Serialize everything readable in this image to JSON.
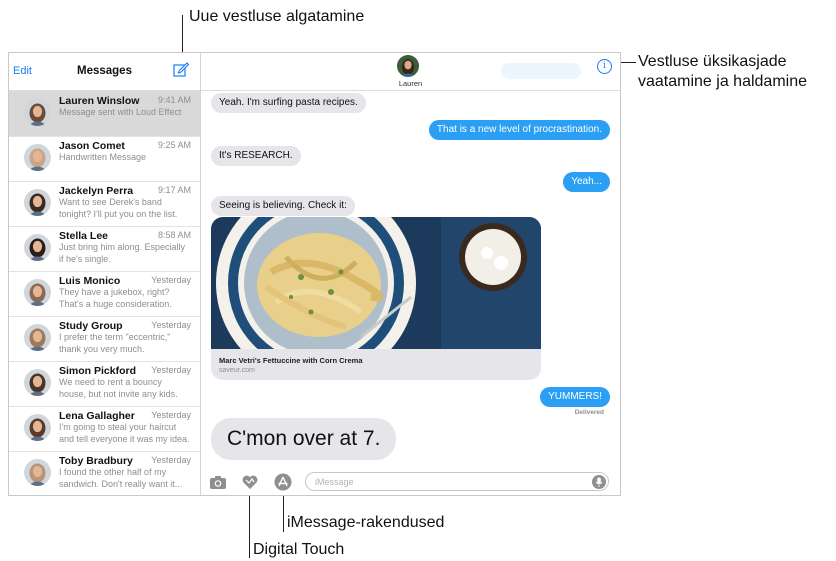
{
  "callouts": {
    "new_conversation": "Uue vestluse algatamine",
    "details_line1": "Vestluse üksikasjade",
    "details_line2": "vaatamine ja haldamine",
    "imessage_apps": "iMessage-rakendused",
    "digital_touch": "Digital Touch"
  },
  "sidebar": {
    "edit_label": "Edit",
    "title": "Messages",
    "compose_icon": "compose-icon",
    "conversations": [
      {
        "name": "Lauren Winslow",
        "time": "9:41 AM",
        "preview": "Message sent with Loud Effect",
        "selected": true,
        "avatar_color": "#6b4a3a"
      },
      {
        "name": "Jason Comet",
        "time": "9:25 AM",
        "preview": "Handwritten Message",
        "selected": false,
        "avatar_color": "#c9a58a"
      },
      {
        "name": "Jackelyn Perra",
        "time": "9:17 AM",
        "preview": "Want to see Derek's band\ntonight? I'll put you on the list.",
        "selected": false,
        "avatar_color": "#3b2a22"
      },
      {
        "name": "Stella Lee",
        "time": "8:58 AM",
        "preview": "Just bring him along. Especially\nif he's single.",
        "selected": false,
        "avatar_color": "#2a1e1a"
      },
      {
        "name": "Luis Monico",
        "time": "Yesterday",
        "preview": "They have a jukebox, right?\nThat's a huge consideration.",
        "selected": false,
        "avatar_color": "#8a6a55"
      },
      {
        "name": "Study Group",
        "time": "Yesterday",
        "preview": "I prefer the term \"eccentric,\"\nthank you very much.",
        "selected": false,
        "avatar_color": "#a0785a"
      },
      {
        "name": "Simon Pickford",
        "time": "Yesterday",
        "preview": "We need to rent a bouncy\nhouse, but not invite any kids.",
        "selected": false,
        "avatar_color": "#4a3328"
      },
      {
        "name": "Lena Gallagher",
        "time": "Yesterday",
        "preview": "I'm going to steal your haircut\nand tell everyone it was my idea.",
        "selected": false,
        "avatar_color": "#5a3a2a"
      },
      {
        "name": "Toby Bradbury",
        "time": "Yesterday",
        "preview": "I found the other half of my\nsandwich. Don't really want it...",
        "selected": false,
        "avatar_color": "#b89478"
      }
    ]
  },
  "chat": {
    "contact_name": "Lauren",
    "info_icon": "info-icon",
    "messages": [
      {
        "text": "Yeah. I'm surfing pasta recipes.",
        "dir": "in"
      },
      {
        "text": "That is a new level of procrastination.",
        "dir": "out"
      },
      {
        "text": "It's RESEARCH.",
        "dir": "in"
      },
      {
        "text": "Yeah...",
        "dir": "out"
      },
      {
        "text": "Seeing is believing. Check it:",
        "dir": "in"
      },
      {
        "text": "YUMMERS!",
        "dir": "out"
      }
    ],
    "link_card": {
      "title": "Marc Vetri's Fettuccine with Corn Crema",
      "source": "saveur.com"
    },
    "delivered_label": "Delivered",
    "loud_message": "C'mon over at 7.",
    "input_placeholder": "iMessage",
    "toolbar_icons": [
      "camera-icon",
      "digital-touch-icon",
      "app-store-icon",
      "microphone-icon"
    ]
  },
  "colors": {
    "accent": "#1a7cf5",
    "outgoing_bubble": "#2b9ff3",
    "incoming_bubble": "#e5e5ea",
    "selected_row": "#d9d9d9"
  }
}
